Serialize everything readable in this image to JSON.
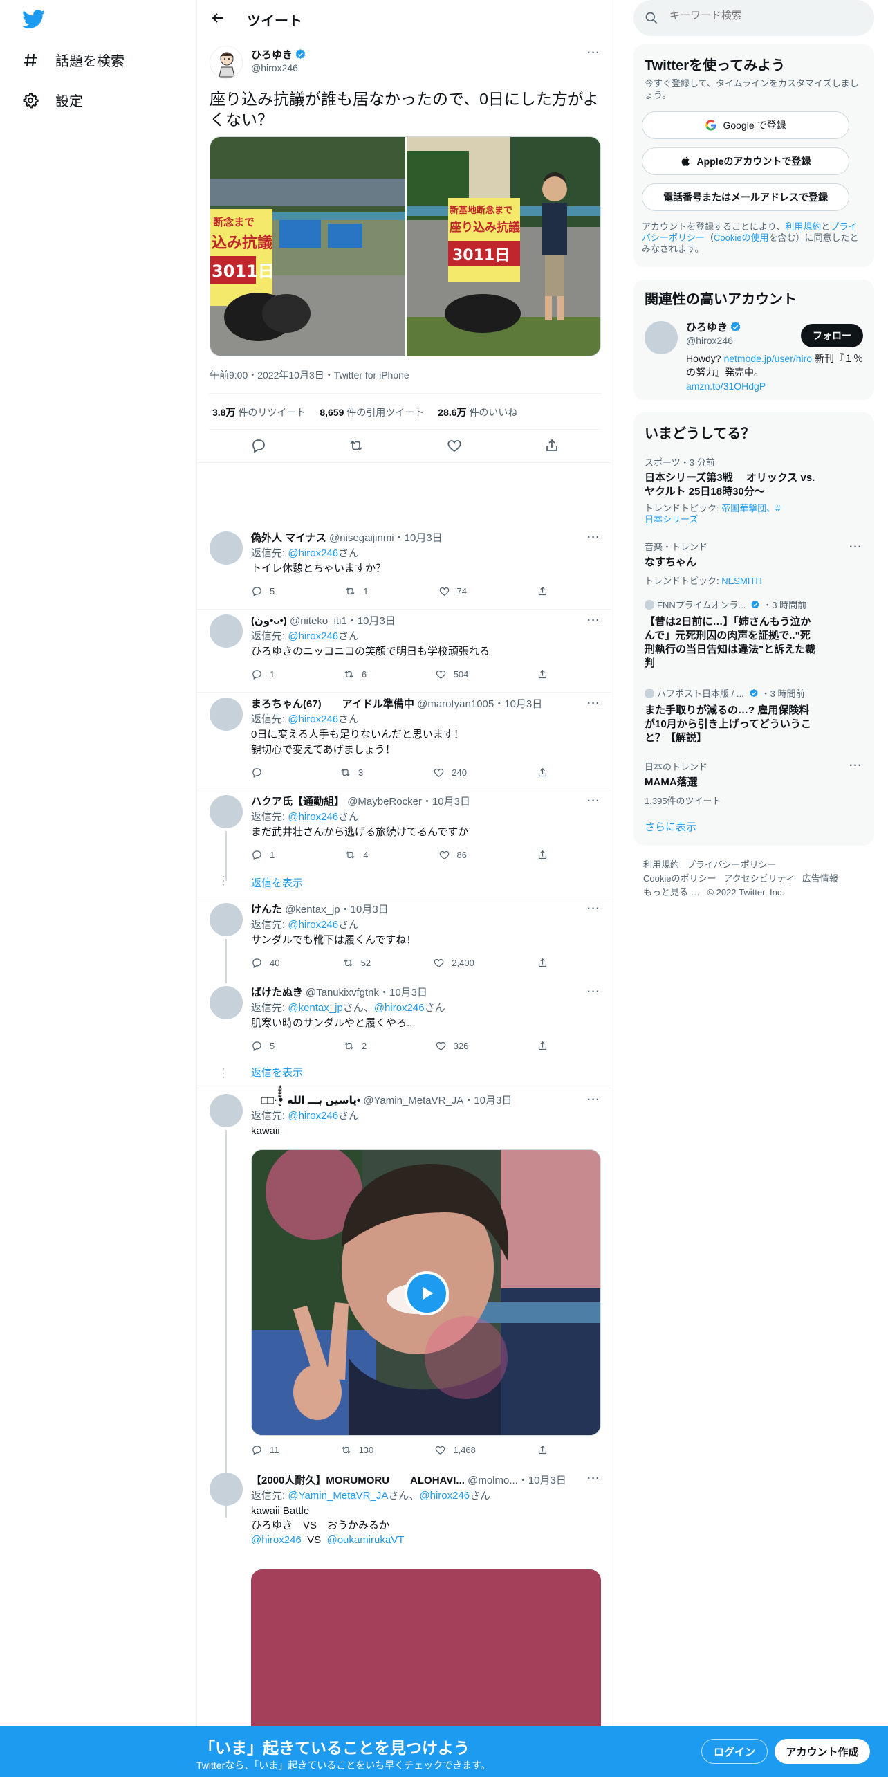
{
  "nav": {
    "explore": "話題を検索",
    "settings": "設定"
  },
  "header": {
    "title": "ツイート"
  },
  "tweet": {
    "name": "ひろゆき",
    "handle": "@hirox246",
    "text": "座り込み抗議が誰も居なかったので、0日にした方がよくない？",
    "img1_text": [
      "断念まで",
      "込み抗議",
      "3011日"
    ],
    "img2_text": [
      "新基地断念まで",
      "座り込み抗議",
      "3011日"
    ],
    "meta": "午前9:00・2022年10月3日・Twitter for iPhone",
    "stats": {
      "retweets": "3.8万",
      "retweets_label": "件のリツイート",
      "quotes": "8,659",
      "quotes_label": "件の引用ツイート",
      "likes": "28.6万",
      "likes_label": "件のいいね"
    }
  },
  "replies": [
    {
      "name": "偽外人 マイナス",
      "handle": "@nisegaijinmi",
      "date": "・10月3日",
      "replyto_prefix": "返信先: ",
      "replyto": "@hirox246",
      "replyto_suffix": "さん",
      "lines": [
        "トイレ休憩とちゃいますか？"
      ],
      "reply": "5",
      "rt": "1",
      "like": "74"
    },
    {
      "name": "(ون•ᴗ•)",
      "handle": "@niteko_iti1",
      "date": "・10月3日",
      "replyto_prefix": "返信先: ",
      "replyto": "@hirox246",
      "replyto_suffix": "さん",
      "lines": [
        "ひろゆきのニッコニコの笑顔で明日も学校頑張れる"
      ],
      "reply": "1",
      "rt": "6",
      "like": "504"
    },
    {
      "name": "まろちゃん(67)　　アイドル準備中",
      "handle": "@marotyan1005",
      "date": "・10月3日",
      "replyto_prefix": "返信先: ",
      "replyto": "@hirox246",
      "replyto_suffix": "さん",
      "lines": [
        "0日に変える人手も足りないんだと思います！",
        "親切心で変えてあげましょう！"
      ],
      "reply": "",
      "rt": "3",
      "like": "240"
    },
    {
      "name": "ハクア氏【通勤組】",
      "handle": "@MaybeRocker",
      "date": "・10月3日",
      "replyto_prefix": "返信先: ",
      "replyto": "@hirox246",
      "replyto_suffix": "さん",
      "lines": [
        "まだ武井壮さんから逃げる旅続けてるんですか"
      ],
      "reply": "1",
      "rt": "4",
      "like": "86"
    },
    {
      "name": "けんた",
      "handle": "@kentax_jp",
      "date": "・10月3日",
      "replyto_prefix": "返信先: ",
      "replyto": "@hirox246",
      "replyto_suffix": "さん",
      "lines": [
        "サンダルでも靴下は履くんですね！"
      ],
      "reply": "40",
      "rt": "52",
      "like": "2,400"
    },
    {
      "name": "ばけたぬき",
      "handle": "@Tanukixvfgtnk",
      "date": "・10月3日",
      "replyto_prefix": "返信先: ",
      "replyto": "@kentax_jp",
      "replyto_mid": "さん、",
      "replyto2": "@hirox246",
      "replyto_suffix": "さん",
      "lines": [
        "肌寒い時のサンダルやと履くやろ..."
      ],
      "reply": "5",
      "rt": "2",
      "like": "326"
    },
    {
      "name": "　□□·•ٌٍّّّٰٰ ياسين بـــ الله•",
      "handle": "@Yamin_MetaVR_JA",
      "date": "・10月3日",
      "replyto_prefix": "返信先: ",
      "replyto": "@hirox246",
      "replyto_suffix": "さん",
      "lines": [
        "kawaii"
      ],
      "reply": "11",
      "rt": "130",
      "like": "1,468"
    },
    {
      "name": "【2000人耐久】MORUMORU　　ALOHAVI...",
      "handle": "@molmo...",
      "date": "・10月3日",
      "replyto_prefix": "返信先: ",
      "replyto": "@Yamin_MetaVR_JA",
      "replyto_mid": "さん、",
      "replyto2": "@hirox246",
      "replyto_suffix": "さん",
      "lines": [
        "kawaii Battle",
        "ひろゆき　VS　おうかみるか"
      ],
      "mention1": "@hirox246",
      "vs": "  VS  ",
      "mention2": "@oukamirukaVT"
    }
  ],
  "show_replies": "返信を表示",
  "search": {
    "placeholder": "キーワード検索"
  },
  "signup": {
    "title": "Twitterを使ってみよう",
    "subtitle": "今すぐ登録して、タイムラインをカスタマイズしましょう。",
    "google": "Google で登録",
    "apple": "Appleのアカウントで登録",
    "phone": "電話番号またはメールアドレスで登録",
    "terms_1": "アカウントを登録することにより、",
    "terms_link1": "利用規約",
    "terms_2": "と",
    "terms_link2": "プライバシーポリシー",
    "terms_3": "（",
    "terms_link3": "Cookieの使用",
    "terms_4": "を含む）に同意したとみなされます。"
  },
  "related": {
    "title": "関連性の高いアカウント",
    "name": "ひろゆき",
    "handle": "@hirox246",
    "follow": "フォロー",
    "bio_1": "Howdy? ",
    "bio_link1": "netmode.jp/user/hiro",
    "bio_2": " 新刊『１％の努力』発売中。",
    "bio_link2": "amzn.to/31OHdgP"
  },
  "trends": {
    "title": "いまどうしてる？",
    "items": [
      {
        "meta": "スポーツ・3 分前",
        "title": "日本シリーズ第3戦　 オリックス vs. ヤクルト 25日18時30分〜",
        "topic_prefix": "トレンドトピック: ",
        "topic": "帝国華撃団、#日本シリーズ"
      },
      {
        "meta": "音楽・トレンド",
        "title": "なすちゃん",
        "topic_prefix": "トレンドトピック: ",
        "topic": "NESMITH"
      },
      {
        "meta": "FNNプライムオンラ...",
        "meta_time": "・3 時間前",
        "title": "【昔は2日前に…】「姉さんもう泣かんで」元死刑囚の肉声を証拠で..\"死刑執行の当日告知は違法\"と訴えた裁判"
      },
      {
        "meta": "ハフポスト日本版 / ...",
        "meta_time": "・3 時間前",
        "title": "また手取りが減るの…? 雇用保険料が10月から引き上げってどういうこと？【解説】"
      },
      {
        "meta": "日本のトレンド",
        "title": "MAMA落選",
        "count": "1,395件のツイート"
      }
    ],
    "more": "さらに表示"
  },
  "footer": {
    "links": [
      "利用規約",
      "プライバシーポリシー",
      "Cookieのポリシー",
      "アクセシビリティ",
      "広告情報",
      "もっと見る …"
    ],
    "copyright": "© 2022 Twitter, Inc."
  },
  "bottom": {
    "title": "「いま」起きていることを見つけよう",
    "subtitle": "Twitterなら、「いま」起きていることをいち早くチェックできます。",
    "login": "ログイン",
    "signup": "アカウント作成"
  },
  "colors": {
    "accent": "#1d9bf0",
    "text": "#0f1419",
    "muted": "#536471"
  }
}
